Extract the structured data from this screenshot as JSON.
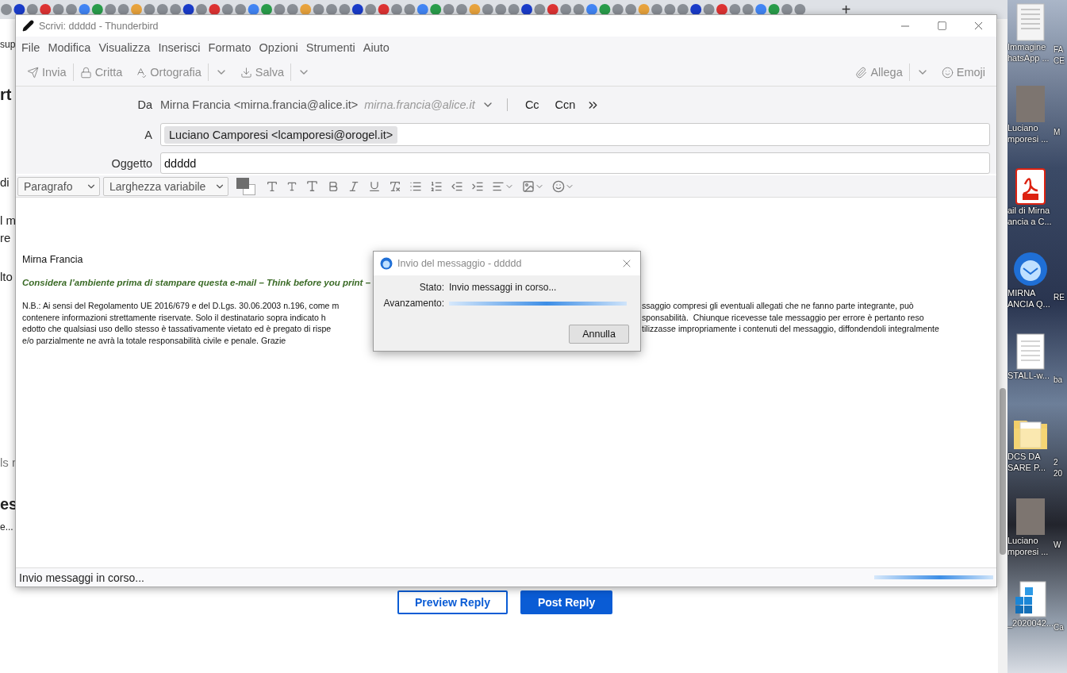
{
  "browser": {
    "new_tab": "+",
    "page_fragments": [
      {
        "text": "sup",
        "kind": "small"
      },
      {
        "text": "rt",
        "kind": "heading"
      },
      {
        "text": "di",
        "kind": "text"
      },
      {
        "text": "l m",
        "kind": "text"
      },
      {
        "text": "re",
        "kind": "text"
      },
      {
        "text": "lto",
        "kind": "text"
      },
      {
        "text": "ls r",
        "kind": "muted"
      },
      {
        "text": "es",
        "kind": "heading"
      },
      {
        "text": "e...",
        "kind": "small"
      }
    ],
    "buttons": [
      {
        "label": "Preview Reply",
        "kind": "outline"
      },
      {
        "label": "Post Reply",
        "kind": "primary"
      }
    ]
  },
  "desktop": {
    "icons": [
      {
        "kind": "image",
        "lines": [
          "Immagine",
          "hatsApp ..."
        ],
        "neighbor": [
          "FA",
          "CE"
        ]
      },
      {
        "kind": "photo",
        "lines": [
          "Luciano",
          "mporesi ..."
        ],
        "neighbor": [
          "M"
        ]
      },
      {
        "kind": "pdf",
        "lines": [
          "ail di Mirna",
          "ancia a C..."
        ]
      },
      {
        "kind": "mail",
        "lines": [
          "MIRNA",
          "ANCIA Q..."
        ],
        "neighbor": [
          "RE"
        ]
      },
      {
        "kind": "document",
        "lines": [
          "STALL-w..."
        ],
        "neighbor": [
          "ba"
        ]
      },
      {
        "kind": "folder",
        "lines": [
          "DCS DA",
          "SARE P..."
        ],
        "neighbor": [
          "2",
          "20"
        ]
      },
      {
        "kind": "photo",
        "lines": [
          "Luciano",
          "mporesi ..."
        ],
        "neighbor": [
          "W"
        ]
      },
      {
        "kind": "package",
        "lines": [
          "_2020042..."
        ],
        "neighbor": [
          "Ca"
        ]
      }
    ]
  },
  "compose": {
    "title": "Scrivi: ddddd - Thunderbird",
    "menu": [
      "File",
      "Modifica",
      "Visualizza",
      "Inserisci",
      "Formato",
      "Opzioni",
      "Strumenti",
      "Aiuto"
    ],
    "toolbar": [
      {
        "kind": "send",
        "label": "Invia",
        "disabled": true
      },
      {
        "kind": "encrypt",
        "label": "Critta",
        "disabled": true
      },
      {
        "kind": "spell",
        "label": "Ortografia",
        "disabled": true
      },
      {
        "kind": "dropdown",
        "disabled": true
      },
      {
        "kind": "save",
        "label": "Salva",
        "disabled": true
      },
      {
        "kind": "dropdown",
        "disabled": true
      }
    ],
    "toolbar_right": [
      {
        "kind": "attach",
        "label": "Allega",
        "disabled": true
      },
      {
        "kind": "dropdown",
        "disabled": true
      },
      {
        "kind": "emoji",
        "label": "Emoji",
        "disabled": true
      }
    ],
    "from": {
      "label": "Da",
      "value": "Mirna Francia <mirna.francia@alice.it>",
      "identity": "mirna.francia@alice.it",
      "cc": "Cc",
      "bcc": "Ccn"
    },
    "to": {
      "label": "A",
      "recipients": [
        "Luciano Camporesi <lcamporesi@orogel.it>"
      ]
    },
    "subject": {
      "label": "Oggetto",
      "value": "ddddd"
    },
    "format_bar": {
      "paragraph": "Paragrafo",
      "font": "Larghezza variabile"
    },
    "body": {
      "signature_name": "Mirna Francia",
      "notice": "Considera l’ambiente prima di stampare questa e-mail – Think before you print –",
      "disclaimer": [
        {
          "left": "N.B.: Ai sensi del Regolamento UE 2016/679 e del D.Lgs. 30.06.2003 n.196, come m",
          "right": "ssaggio compresi gli eventuali allegati che ne fanno parte integrante, può"
        },
        {
          "left": "contenere informazioni strettamente riservate. Solo il destinatario sopra indicato h",
          "right": "sponsabilità.  Chiunque ricevesse tale messaggio per errore è pertanto reso"
        },
        {
          "left": "edotto che qualsiasi uso dello stesso è tassativamente vietato ed è pregato di rispe",
          "right": "tilizzasse impropriamente i contenuti del messaggio, diffondendoli integralmente"
        },
        {
          "left": "e/o parzialmente ne avrà la totale responsabilità civile e penale. Grazie"
        }
      ]
    },
    "status": "Invio messaggi in corso...",
    "status_progress": {
      "busy": true
    }
  },
  "dialog": {
    "title": "Invio del messaggio - ddddd",
    "rows": [
      {
        "kind": "text",
        "label": "Stato:",
        "value": "Invio messaggi in corso..."
      },
      {
        "kind": "progress",
        "label": "Avanzamento:",
        "busy": true
      }
    ],
    "button": "Annulla"
  }
}
